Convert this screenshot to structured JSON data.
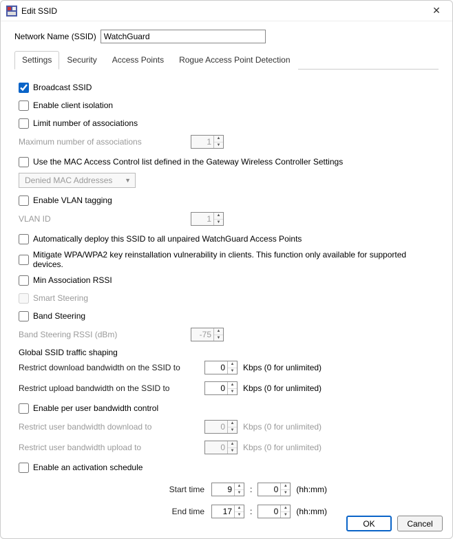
{
  "window": {
    "title": "Edit SSID"
  },
  "form": {
    "ssid_label": "Network Name (SSID)",
    "ssid_value": "WatchGuard"
  },
  "tabs": {
    "settings": "Settings",
    "security": "Security",
    "access_points": "Access Points",
    "rogue": "Rogue Access Point Detection"
  },
  "settings": {
    "broadcast_ssid": "Broadcast SSID",
    "client_isolation": "Enable client isolation",
    "limit_assoc": "Limit number of associations",
    "max_assoc_label": "Maximum number of associations",
    "max_assoc_value": "1",
    "mac_acl": "Use the MAC Access Control list defined in the Gateway Wireless Controller Settings",
    "mac_acl_combo": "Denied MAC Addresses",
    "vlan_tagging": "Enable VLAN tagging",
    "vlan_id_label": "VLAN ID",
    "vlan_id_value": "1",
    "auto_deploy": "Automatically deploy this SSID to all unpaired WatchGuard Access Points",
    "mitigate_wpa": "Mitigate WPA/WPA2 key reinstallation vulnerability in clients. This function only available for supported devices.",
    "min_rssi": "Min Association RSSI",
    "smart_steering": "Smart Steering",
    "band_steering": "Band Steering",
    "band_rssi_label": "Band Steering RSSI (dBm)",
    "band_rssi_value": "-75",
    "global_shaping": "Global SSID traffic shaping",
    "dl_label": "Restrict download bandwidth on the SSID to",
    "dl_value": "0",
    "ul_label": "Restrict upload bandwidth on the SSID to",
    "ul_value": "0",
    "kbps_suffix": "Kbps (0 for unlimited)",
    "per_user_bw": "Enable per user bandwidth control",
    "user_dl_label": "Restrict user bandwidth download to",
    "user_dl_value": "0",
    "user_ul_label": "Restrict user bandwidth upload to",
    "user_ul_value": "0",
    "activation_schedule": "Enable an activation schedule",
    "start_label": "Start time",
    "start_hh": "9",
    "start_mm": "0",
    "end_label": "End time",
    "end_hh": "17",
    "end_mm": "0",
    "hhmm": "(hh:mm)"
  },
  "buttons": {
    "ok": "OK",
    "cancel": "Cancel"
  }
}
